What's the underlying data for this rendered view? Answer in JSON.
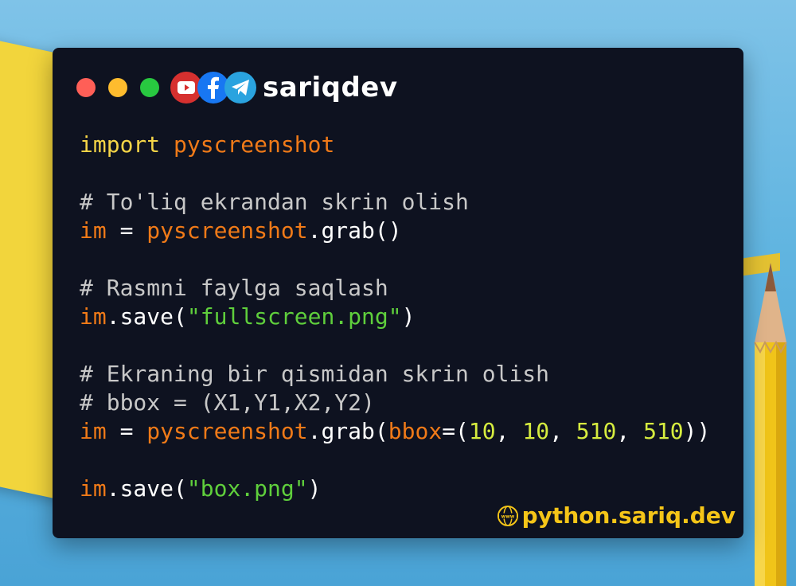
{
  "brand": {
    "name": "sariqdev",
    "icons": [
      "youtube-icon",
      "facebook-icon",
      "telegram-icon"
    ]
  },
  "window_controls": [
    "close",
    "minimize",
    "maximize"
  ],
  "colors": {
    "keyword": "#f5d547",
    "variable": "#f07a18",
    "comment": "#c8c8c8",
    "string": "#5fcf3c",
    "number": "#d6ec3f",
    "background": "#0e1220",
    "watermark": "#f5c518"
  },
  "code": {
    "l1": {
      "kw": "import",
      "sp": " ",
      "mod": "pyscreenshot"
    },
    "l3": {
      "comment": "# To'liq ekrandan skrin olish"
    },
    "l4": {
      "var": "im",
      "eq": " = ",
      "mod": "pyscreenshot",
      "call": ".grab()"
    },
    "l6": {
      "comment": "# Rasmni faylga saqlash"
    },
    "l7": {
      "var": "im",
      "call": ".save(",
      "str": "\"fullscreen.png\"",
      "close": ")"
    },
    "l9": {
      "comment": "# Ekraning bir qismidan skrin olish"
    },
    "l10": {
      "comment": "# bbox = (X1,Y1,X2,Y2)"
    },
    "l11": {
      "var": "im",
      "eq": " = ",
      "mod": "pyscreenshot",
      "call": ".grab(",
      "param": "bbox",
      "open": "=(",
      "n1": "10",
      "c1": ", ",
      "n2": "10",
      "c2": ", ",
      "n3": "510",
      "c3": ", ",
      "n4": "510",
      "close": "))"
    },
    "l13": {
      "var": "im",
      "call": ".save(",
      "str": "\"box.png\"",
      "close": ")"
    }
  },
  "watermark": {
    "icon": "www-globe-icon",
    "text": "python.sariq.dev"
  }
}
